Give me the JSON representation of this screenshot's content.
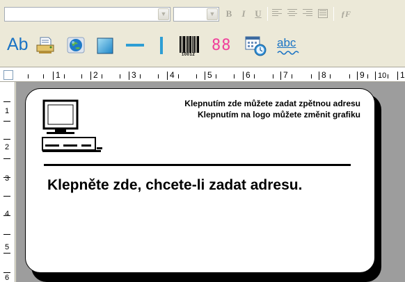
{
  "toolbar_format": {
    "font_name_value": "",
    "font_size_value": "",
    "bold_label": "B",
    "italic_label": "I",
    "underline_label": "U",
    "function_label": "ƒF"
  },
  "toolbar_tools": {
    "text_tool_label": "Ab",
    "barcode_digits": "10012",
    "counter_digits": "88",
    "spell_label": "abc"
  },
  "ruler_horizontal": [
    "1",
    "2",
    "3",
    "4",
    "5",
    "6",
    "7",
    "8",
    "9",
    "10",
    "1"
  ],
  "ruler_vertical": [
    "1",
    "2",
    "3",
    "4",
    "5",
    "6"
  ],
  "label": {
    "return_address_hint": "Klepnutím zde můžete zadat zpětnou adresu",
    "logo_hint": "Klepnutím na logo můžete změnit grafiku",
    "address_hint": "Klepněte zde, chcete-li zadat adresu."
  },
  "colors": {
    "toolbar_bg": "#ece9d8",
    "canvas_bg": "#9d9d9d",
    "tool_blue": "#1a73c4"
  },
  "icons": [
    "chevron-down-icon",
    "bold-icon",
    "italic-icon",
    "underline-icon",
    "align-left-icon",
    "align-center-icon",
    "align-right-icon",
    "justify-icon",
    "function-icon",
    "text-icon",
    "printer-icon",
    "picture-icon",
    "rectangle-icon",
    "horizontal-line-icon",
    "vertical-line-icon",
    "barcode-icon",
    "counter-icon",
    "date-time-icon",
    "spell-check-icon",
    "computer-icon"
  ]
}
